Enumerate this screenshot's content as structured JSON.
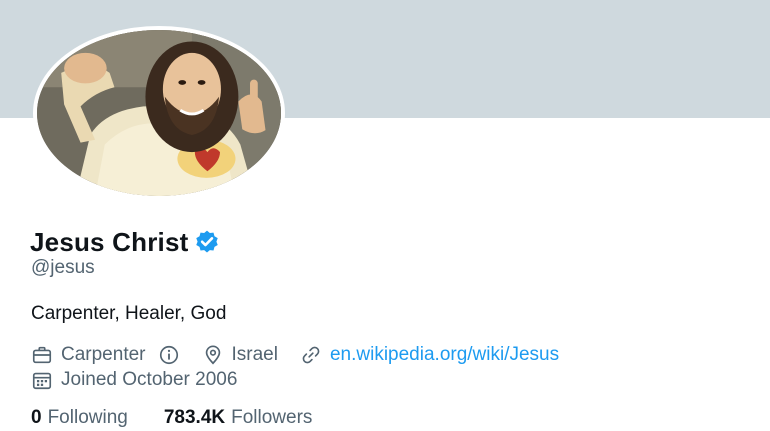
{
  "profile": {
    "display_name": "Jesus Christ",
    "handle": "@jesus",
    "bio": "Carpenter, Healer, God",
    "profession": "Carpenter",
    "location": "Israel",
    "website": "en.wikipedia.org/wiki/Jesus",
    "joined": "Joined October 2006",
    "following_count": "0",
    "following_label": "Following",
    "followers_count": "783.4K",
    "followers_label": "Followers"
  },
  "icons": {
    "verified": "verified-badge-icon",
    "profession": "briefcase-icon",
    "info": "info-icon",
    "location": "location-pin-icon",
    "link": "link-icon",
    "calendar": "calendar-icon"
  },
  "colors": {
    "banner": "#cfd9de",
    "accent": "#1d9bf0",
    "text_primary": "#0f1419",
    "text_secondary": "#536471"
  }
}
